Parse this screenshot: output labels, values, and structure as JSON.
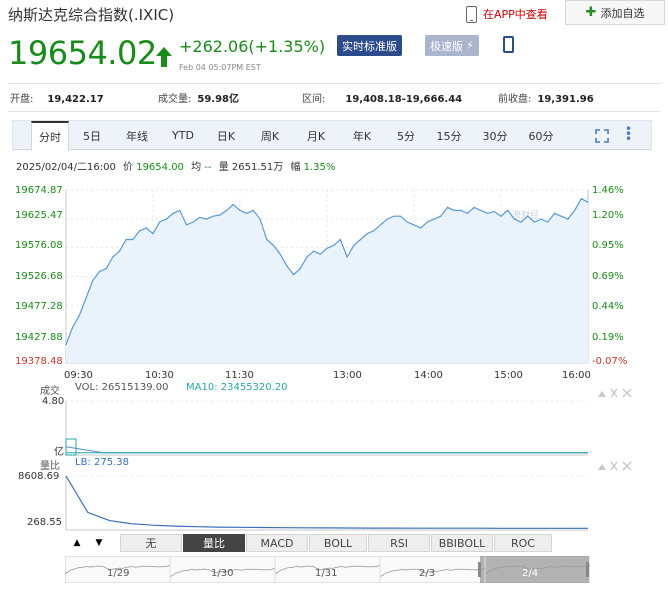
{
  "header": {
    "title": "纳斯达克综合指数(.IXIC)",
    "app_link": "在APP中查看",
    "watchlist_button": "添加自选",
    "price": "19654.02",
    "change": "+262.06(+1.35%)",
    "timestamp": "Feb 04 05:07PM EST",
    "badge_realtime": "实时标准版",
    "badge_fast": "极速版",
    "icons": {
      "app": "phone-icon",
      "watch": "plus-icon",
      "trend": "up-arrow-icon",
      "fast": "lightning-icon",
      "mobile": "mobile-icon"
    }
  },
  "stats": [
    {
      "label": "开盘:",
      "value": "19,422.17"
    },
    {
      "label": "成交量:",
      "value": "59.98亿"
    },
    {
      "label": "区间:",
      "value": "19,408.18-19,666.44"
    },
    {
      "label": "前收盘:",
      "value": "19,391.96"
    }
  ],
  "tabs": [
    "分时",
    "5日",
    "年线",
    "YTD",
    "日K",
    "周K",
    "月K",
    "年K",
    "5分",
    "15分",
    "30分",
    "60分"
  ],
  "active_tab": "分时",
  "info_line": {
    "datetime": "2025/02/04/二16:00",
    "price_label": "价",
    "price": "19654.00",
    "avg_label": "均",
    "avg": "--",
    "volume_label": "量",
    "volume": "2651.51万",
    "amplitude_label": "幅",
    "amplitude": "1.35%"
  },
  "watermark": "新浪财经",
  "chart_data": [
    {
      "type": "line",
      "title": "",
      "x_ticks": [
        "09:30",
        "10:30",
        "11:30",
        "13:00",
        "14:00",
        "15:00",
        "16:00"
      ],
      "y_ticks_left": [
        "19674.87",
        "19625.47",
        "19576.08",
        "19526.68",
        "19477.28",
        "19427.88",
        "19378.48"
      ],
      "y_ticks_right": [
        "1.46%",
        "1.20%",
        "0.95%",
        "0.69%",
        "0.44%",
        "0.19%",
        "-0.07%"
      ],
      "ylim": [
        19378.48,
        19674.87
      ],
      "line_color": "#5a9ad6",
      "series": [
        {
          "x": [
            "09:30",
            "09:35",
            "09:40",
            "09:45",
            "09:50",
            "09:55",
            "10:00",
            "10:05",
            "10:10",
            "10:15",
            "10:20",
            "10:25",
            "10:30",
            "10:35",
            "10:40",
            "10:45",
            "10:50",
            "10:55",
            "11:00",
            "11:05",
            "11:10",
            "11:15",
            "11:20",
            "11:25",
            "11:30",
            "11:35",
            "11:40",
            "11:45",
            "11:50",
            "11:55",
            "12:00",
            "12:05",
            "12:10",
            "12:15",
            "12:20",
            "12:25",
            "12:30",
            "12:35",
            "12:40",
            "12:45",
            "12:50",
            "12:55",
            "13:00",
            "13:05",
            "13:10",
            "13:15",
            "13:20",
            "13:25",
            "13:30",
            "13:35",
            "13:40",
            "13:45",
            "13:50",
            "13:55",
            "14:00",
            "14:05",
            "14:10",
            "14:15",
            "14:20",
            "14:25",
            "14:30",
            "14:35",
            "14:40",
            "14:45",
            "14:50",
            "14:55",
            "15:00",
            "15:05",
            "15:10",
            "15:15",
            "15:20",
            "15:25",
            "15:30",
            "15:35",
            "15:40",
            "15:45",
            "15:50",
            "15:55",
            "16:00"
          ],
          "values": [
            19410,
            19440,
            19460,
            19490,
            19520,
            19535,
            19540,
            19560,
            19570,
            19590,
            19590,
            19605,
            19610,
            19600,
            19620,
            19625,
            19635,
            19640,
            19615,
            19620,
            19628,
            19625,
            19630,
            19632,
            19640,
            19650,
            19640,
            19635,
            19640,
            19625,
            19590,
            19580,
            19565,
            19545,
            19530,
            19540,
            19560,
            19570,
            19565,
            19575,
            19580,
            19590,
            19560,
            19580,
            19590,
            19600,
            19605,
            19615,
            19625,
            19630,
            19630,
            19620,
            19615,
            19610,
            19620,
            19625,
            19630,
            19645,
            19640,
            19640,
            19635,
            19645,
            19640,
            19635,
            19638,
            19630,
            19640,
            19625,
            19620,
            19630,
            19620,
            19625,
            19620,
            19635,
            19630,
            19625,
            19640,
            19660,
            19654
          ]
        }
      ]
    },
    {
      "type": "line",
      "title": "成交",
      "vol_label": "VOL: 26515139.00",
      "ma_label": "MA10: 23455320.20",
      "y_ticks": [
        "4.80",
        "亿"
      ],
      "series": [
        {
          "name": "VOL",
          "color": "#5b8fc7",
          "values": [
            4.8,
            0.25,
            0.22,
            0.2,
            0.2,
            0.19,
            0.2,
            0.19,
            0.18,
            0.19,
            0.2,
            0.19,
            0.2,
            0.21,
            0.26
          ]
        },
        {
          "name": "MA10",
          "color": "#2aa6a6",
          "values": [
            0.22,
            0.22,
            0.21,
            0.21,
            0.2,
            0.2,
            0.2,
            0.2,
            0.19,
            0.2,
            0.2,
            0.2,
            0.2,
            0.21,
            0.23
          ]
        }
      ]
    },
    {
      "type": "line",
      "title": "量比",
      "lb_label": "LB: 275.38",
      "y_ticks": [
        "8608.69",
        "268.55"
      ],
      "ylim": [
        0,
        8608.69
      ],
      "series": [
        {
          "name": "LB",
          "color": "#3a6fb8",
          "values": [
            8608.69,
            2800,
            1500,
            1000,
            760,
            620,
            520,
            470,
            430,
            400,
            370,
            350,
            330,
            315,
            305,
            298,
            292,
            287,
            283,
            280,
            278,
            277,
            276,
            275.5,
            275.38
          ]
        }
      ]
    }
  ],
  "indicator_buttons": [
    "无",
    "量比",
    "MACD",
    "BOLL",
    "RSI",
    "BBIBOLL",
    "ROC"
  ],
  "active_indicator": "量比",
  "nav": {
    "up": "▲",
    "down": "▼"
  },
  "timeline": [
    "1/29",
    "1/30",
    "1/31",
    "2/3",
    "2/4"
  ],
  "colors": {
    "green": "#1a8a1a",
    "red": "#c0392b",
    "navy": "#2b4b8a",
    "line": "#5a9ad6"
  }
}
